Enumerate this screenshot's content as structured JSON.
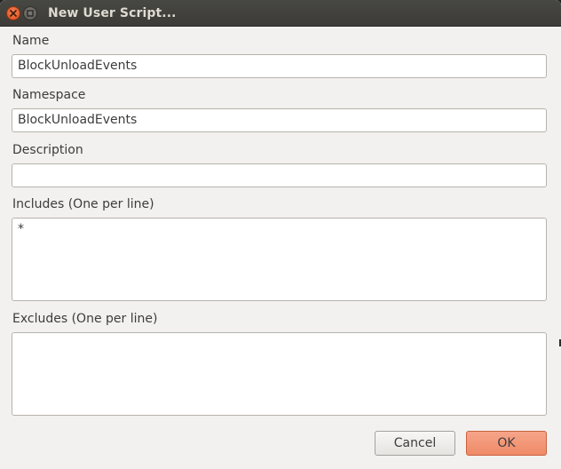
{
  "window": {
    "title": "New User Script..."
  },
  "form": {
    "name": {
      "label": "Name",
      "value": "BlockUnloadEvents"
    },
    "namespace": {
      "label": "Namespace",
      "value": "BlockUnloadEvents"
    },
    "description": {
      "label": "Description",
      "value": ""
    },
    "includes": {
      "label": "Includes (One per line)",
      "value": "*"
    },
    "excludes": {
      "label": "Excludes (One per line)",
      "value": ""
    }
  },
  "buttons": {
    "cancel_label": "Cancel",
    "ok_label": "OK"
  },
  "colors": {
    "ok_accent": "#ef8a67",
    "titlebar": "#3c3b37",
    "close_button": "#df4b17"
  },
  "icons": {
    "close": "close-icon",
    "minimize": "minimize-icon"
  }
}
